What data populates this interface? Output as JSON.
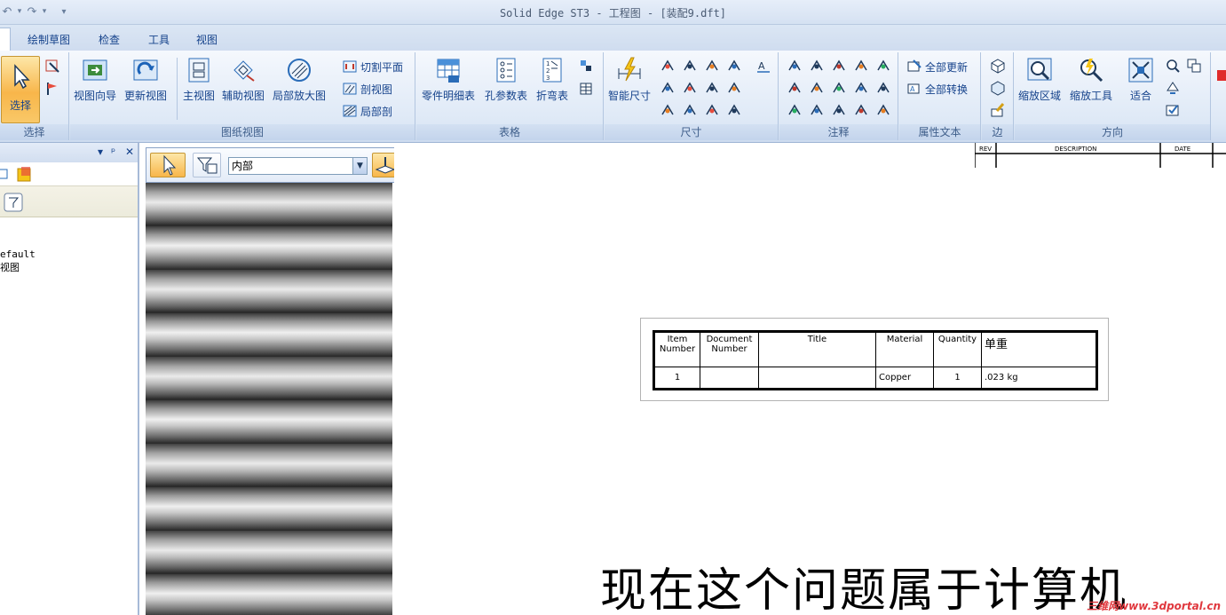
{
  "window": {
    "title": "Solid Edge ST3 - 工程图 - [装配9.dft]"
  },
  "qat": {
    "undo_icon": "undo-icon",
    "redo_icon": "redo-icon",
    "more": "▾"
  },
  "tabs": [
    "绘制草图",
    "检查",
    "工具",
    "视图"
  ],
  "ribbon": {
    "select_group": {
      "label": "选择",
      "select_button": "选择"
    },
    "drawing_views": {
      "label": "图纸视图",
      "view_wizard": "视图向导",
      "update_views": "更新视图",
      "principal": "主视图",
      "auxiliary": "辅助视图",
      "detail": "局部放大图",
      "cutting_plane": "切割平面",
      "section": "剖视图",
      "broken_out": "局部剖"
    },
    "tables": {
      "label": "表格",
      "parts_list": "零件明细表",
      "hole_table": "孔参数表",
      "bend_table": "折弯表"
    },
    "dimension": {
      "label": "尺寸",
      "smart_dimension": "智能尺寸"
    },
    "annotation": {
      "label": "注释"
    },
    "property_text": {
      "label": "属性文本",
      "update_all": "全部更新",
      "convert_all": "全部转换"
    },
    "edge": {
      "label": "边"
    },
    "orientation": {
      "label": "方向",
      "zoom_area": "缩放区域",
      "zoom_tool": "缩放工具",
      "fit": "适合"
    }
  },
  "selection_toolbar": {
    "filter_value": "内部"
  },
  "left_panel": {
    "tree_items": [
      "efault",
      "视图"
    ]
  },
  "title_block": {
    "col1": "REV",
    "col2": "DESCRIPTION",
    "col3": "DATE"
  },
  "parts_list": {
    "headers": [
      "Item Number",
      "Document Number",
      "Title",
      "Material",
      "Quantity",
      "单重"
    ],
    "rows": [
      [
        "1",
        "",
        "",
        "Copper",
        "1",
        ".023 kg"
      ]
    ]
  },
  "overlay_text": "现在这个问题属于计算机",
  "watermark": "三维网www.3dportal.cn"
}
